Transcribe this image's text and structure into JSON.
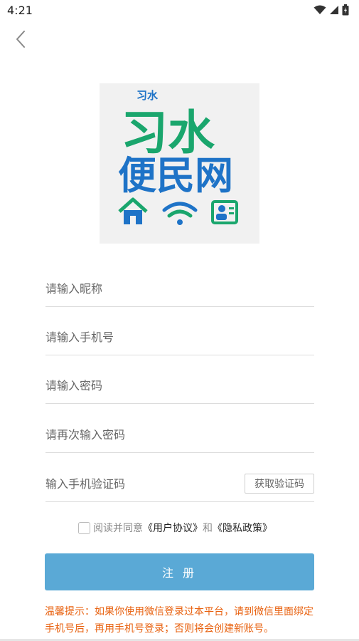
{
  "status_bar": {
    "time": "4:21",
    "icons": [
      "wifi-icon",
      "signal-icon",
      "battery-icon"
    ]
  },
  "nav": {
    "back_icon": "chevron-left-icon"
  },
  "logo": {
    "small_text": "习水",
    "big_text": "习水",
    "sub_text": "便民网",
    "icons": [
      "house-icon",
      "wifi-icon",
      "contacts-icon"
    ],
    "colors": {
      "green": "#1aa66d",
      "blue": "#1e73c7"
    }
  },
  "form": {
    "nickname_placeholder": "请输入昵称",
    "phone_placeholder": "请输入手机号",
    "password_placeholder": "请输入密码",
    "password_confirm_placeholder": "请再次输入密码",
    "sms_code_placeholder": "输入手机验证码",
    "get_code_label": "获取验证码"
  },
  "agreement": {
    "prefix": "阅读并同意",
    "user_agreement": "《用户协议》",
    "and": "和",
    "privacy_policy": "《隐私政策》"
  },
  "register_button": {
    "label": "注 册",
    "color": "#5aa9d6"
  },
  "tip": {
    "text": "温馨提示：如果你使用微信登录过本平台，请到微信里面绑定手机号后，再用手机号登录；否则将会创建新账号。",
    "color": "#e8610f"
  }
}
